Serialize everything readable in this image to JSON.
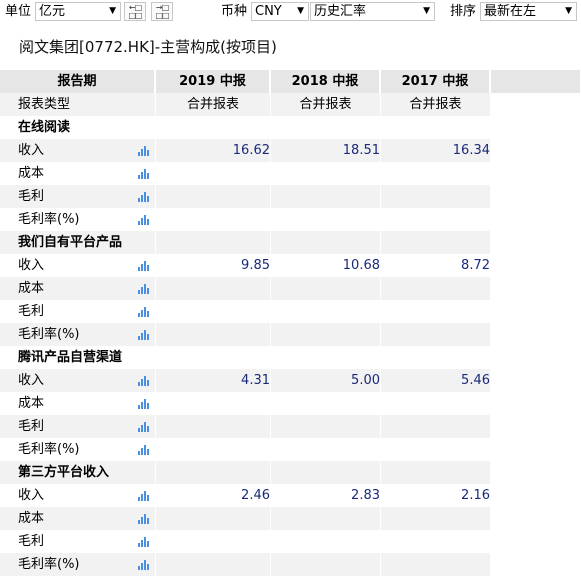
{
  "toolbar": {
    "unit_label": "单位",
    "unit_value": "亿元",
    "currency_label": "币种",
    "currency_value": "CNY",
    "rate_value": "历史汇率",
    "sort_label": "排序",
    "sort_value": "最新在左"
  },
  "page": {
    "title": "阅文集团[0772.HK]-主营构成(按项目)"
  },
  "table": {
    "header": [
      "报告期",
      "2019 中报",
      "2018 中报",
      "2017 中报"
    ],
    "report_type": {
      "label": "报表类型",
      "values": [
        "合并报表",
        "合并报表",
        "合并报表"
      ]
    },
    "sections": [
      {
        "name": "在线阅读",
        "rows": [
          {
            "label": "收入",
            "values": [
              "16.62",
              "18.51",
              "16.34"
            ]
          },
          {
            "label": "成本",
            "values": [
              "",
              "",
              ""
            ]
          },
          {
            "label": "毛利",
            "values": [
              "",
              "",
              ""
            ]
          },
          {
            "label": "毛利率(%)",
            "values": [
              "",
              "",
              ""
            ]
          }
        ]
      },
      {
        "name": "我们自有平台产品",
        "rows": [
          {
            "label": "收入",
            "values": [
              "9.85",
              "10.68",
              "8.72"
            ]
          },
          {
            "label": "成本",
            "values": [
              "",
              "",
              ""
            ]
          },
          {
            "label": "毛利",
            "values": [
              "",
              "",
              ""
            ]
          },
          {
            "label": "毛利率(%)",
            "values": [
              "",
              "",
              ""
            ]
          }
        ]
      },
      {
        "name": "腾讯产品自营渠道",
        "rows": [
          {
            "label": "收入",
            "values": [
              "4.31",
              "5.00",
              "5.46"
            ]
          },
          {
            "label": "成本",
            "values": [
              "",
              "",
              ""
            ]
          },
          {
            "label": "毛利",
            "values": [
              "",
              "",
              ""
            ]
          },
          {
            "label": "毛利率(%)",
            "values": [
              "",
              "",
              ""
            ]
          }
        ]
      },
      {
        "name": "第三方平台收入",
        "rows": [
          {
            "label": "收入",
            "values": [
              "2.46",
              "2.83",
              "2.16"
            ]
          },
          {
            "label": "成本",
            "values": [
              "",
              "",
              ""
            ]
          },
          {
            "label": "毛利",
            "values": [
              "",
              "",
              ""
            ]
          },
          {
            "label": "毛利率(%)",
            "values": [
              "",
              "",
              ""
            ]
          }
        ]
      }
    ]
  },
  "icons": {
    "row_chart": "bar-chart-icon",
    "expand_left": "expand-left-icon",
    "expand_right": "expand-right-icon",
    "dropdown": "chevron-down-icon"
  },
  "colors": {
    "header_bg": "#e6e6e6",
    "shade_bg": "#f2f2f2",
    "value_text": "#1a2a7a",
    "chart_icon": "#4a8fe0"
  }
}
